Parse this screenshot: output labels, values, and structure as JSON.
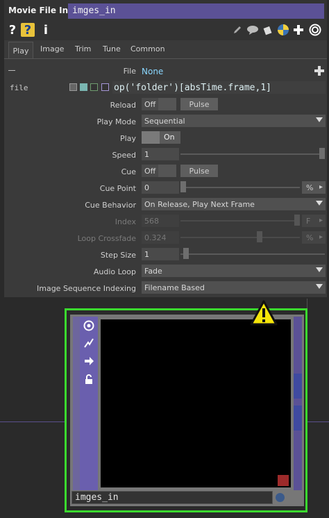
{
  "operator": {
    "type_label": "Movie File In",
    "name": "imges_in"
  },
  "toolbar": {
    "help_icon": "?",
    "python_help_icon": "?",
    "info_icon": "i"
  },
  "tabs": [
    "Play",
    "Image",
    "Trim",
    "Tune",
    "Common"
  ],
  "params": {
    "file_label": "File",
    "file_value": "None",
    "file_expr_label": "file",
    "file_expr": "op('folder')[absTime.frame,1]",
    "reload_label": "Reload",
    "reload_off": "Off",
    "reload_pulse": "Pulse",
    "playmode_label": "Play Mode",
    "playmode_value": "Sequential",
    "play_label": "Play",
    "play_on": "On",
    "speed_label": "Speed",
    "speed_value": "1",
    "cue_label": "Cue",
    "cue_off": "Off",
    "cue_pulse": "Pulse",
    "cuepoint_label": "Cue Point",
    "cuepoint_value": "0",
    "cuepoint_unit": "%",
    "cuebehavior_label": "Cue Behavior",
    "cuebehavior_value": "On Release, Play Next Frame",
    "index_label": "Index",
    "index_value": "568",
    "index_unit": "F",
    "loopcross_label": "Loop Crossfade",
    "loopcross_value": "0.324",
    "loopcross_unit": "%",
    "stepsize_label": "Step Size",
    "stepsize_value": "1",
    "audioloop_label": "Audio Loop",
    "audioloop_value": "Fade",
    "imgseq_label": "Image Sequence Indexing",
    "imgseq_value": "Filename Based"
  },
  "node": {
    "name": "imges_in"
  },
  "colors": {
    "accent": "#5b5196",
    "node_border": "#3ad92e",
    "warning": "#f5e50a"
  }
}
